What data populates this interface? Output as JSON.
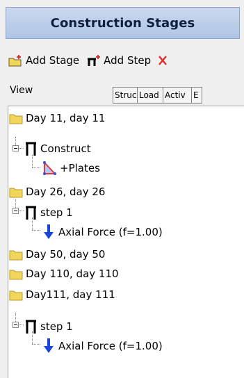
{
  "panel": {
    "title": "Construction Stages"
  },
  "toolbar": {
    "add_stage": "Add Stage",
    "add_step": "Add Step"
  },
  "view": {
    "label": "View",
    "tabs": [
      "Struc",
      "Load",
      "Activ",
      "E"
    ]
  },
  "tree": {
    "stage1": {
      "label": "Day 11, day 11",
      "step": "Construct",
      "item": "+Plates"
    },
    "stage2": {
      "label": "Day 26, day 26",
      "step": "step 1",
      "item": "Axial Force (f=1.00)"
    },
    "stage3": {
      "label": "Day 50, day 50"
    },
    "stage4": {
      "label": "Day 110, day 110"
    },
    "stage5": {
      "label": "Day111, day 111",
      "step": "step 1",
      "item": "Axial Force (f=1.00)"
    }
  },
  "colors": {
    "header": "#b9cde8",
    "folder": "#f2d65c",
    "arrow": "#1847d8",
    "plate": "#e23a3a"
  }
}
